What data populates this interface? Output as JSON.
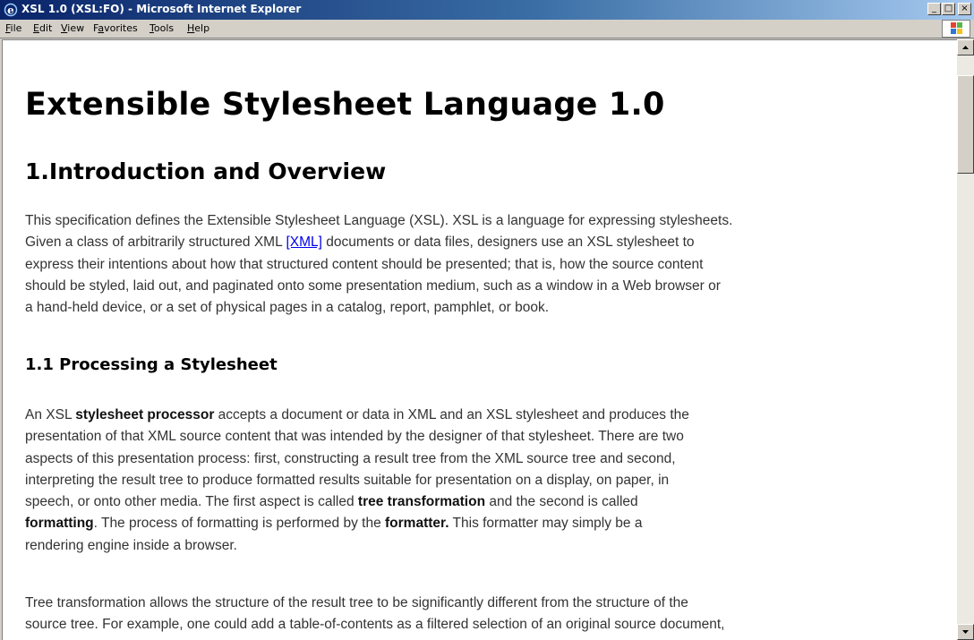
{
  "window": {
    "title": "XSL 1.0 (XSL:FO) - Microsoft Internet Explorer",
    "controls": {
      "minimize": "_",
      "maximize": "□",
      "close": "×"
    }
  },
  "menu": {
    "items": [
      {
        "key": "F",
        "rest": "ile"
      },
      {
        "key": "E",
        "rest": "dit"
      },
      {
        "key": "V",
        "rest": "iew"
      },
      {
        "pre": "F",
        "key": "a",
        "rest": "vorites"
      },
      {
        "key": "T",
        "rest": "ools"
      },
      {
        "key": "H",
        "rest": "elp"
      }
    ]
  },
  "icons": [
    "ie-icon",
    "windows-logo-icon",
    "scroll-up-icon",
    "scroll-down-icon"
  ],
  "colors": {
    "link": "#0000ee",
    "titlebar_start": "#0a246a",
    "titlebar_end": "#a6caf0"
  },
  "doc": {
    "title": "Extensible Stylesheet Language 1.0",
    "section": "1.Introduction and Overview",
    "intro": {
      "l1": "This specification defines the Extensible Stylesheet Language (XSL). XSL is a language for expressing stylesheets.",
      "l2_pre": "Given a class of arbitrarily structured XML ",
      "l2_link": "[XML]",
      "l2_post": " documents or data files, designers use an XSL stylesheet to",
      "l3": "express their intentions about how that structured content should be presented; that is, how the source content",
      "l4": "should be styled, laid out, and paginated onto some presentation medium, such as a window in a Web browser or",
      "l5": "a hand-held device, or a set of physical pages in a catalog, report, pamphlet, or book."
    },
    "subsection": "1.1 Processing a Stylesheet",
    "processing": {
      "l1_pre": "An XSL ",
      "l1_bold": "stylesheet processor",
      "l1_post": " accepts a document or data in XML and an XSL stylesheet and produces the",
      "l2": "presentation of that XML source content that was intended by the designer of that stylesheet. There are two",
      "l3": "aspects of this presentation process: first, constructing a result tree from the XML source tree and second,",
      "l4": "interpreting the result tree to produce formatted results suitable for presentation on a display, on paper, in",
      "l5_pre": "speech, or onto other media. The first aspect is called ",
      "l5_bold": "tree transformation",
      "l5_post": " and the second is called",
      "l6_bold1": "formatting",
      "l6_mid": ". The process of formatting is performed by the ",
      "l6_bold2": "formatter.",
      "l6_post": " This formatter may simply be a",
      "l7": "rendering engine inside a browser."
    },
    "transformation": {
      "l1": "Tree transformation allows the structure of the result tree to be significantly different from the structure of the",
      "l2": "source tree. For example, one could add a table-of-contents as a filtered selection of an original source document,"
    }
  }
}
